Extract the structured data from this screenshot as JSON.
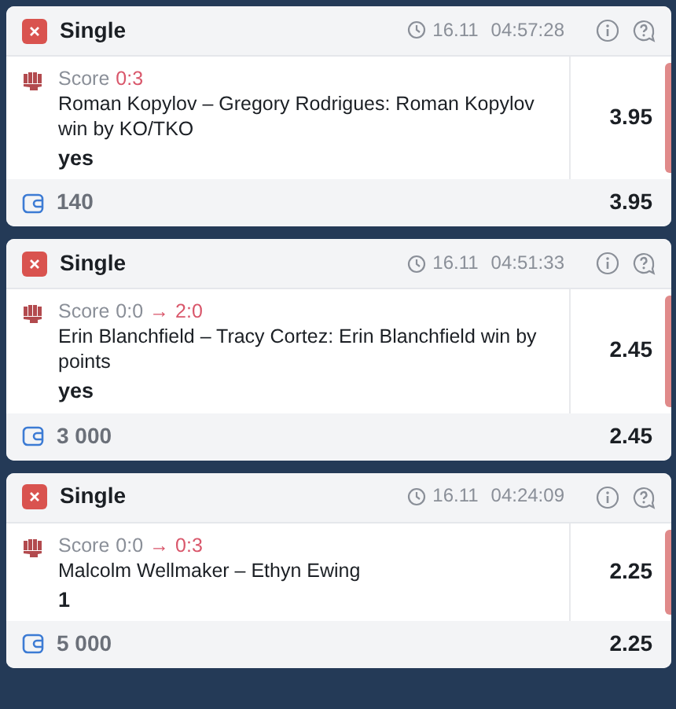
{
  "bets": [
    {
      "type": "Single",
      "lost": true,
      "date": "16.11",
      "time": "04:57:28",
      "score_label": "Score",
      "score_to": "0:3",
      "event": "Roman Kopylov – Gregory Rodrigues: Roman Kopylov win by KO/TKO",
      "pick": "yes",
      "odds": "3.95",
      "stake": "140",
      "total_odds": "3.95"
    },
    {
      "type": "Single",
      "lost": true,
      "date": "16.11",
      "time": "04:51:33",
      "score_label": "Score",
      "score_from": "0:0",
      "arrow": "→",
      "score_to": "2:0",
      "event": "Erin Blanchfield – Tracy Cortez: Erin Blanchfield win by points",
      "pick": "yes",
      "odds": "2.45",
      "stake": "3 000",
      "total_odds": "2.45"
    },
    {
      "type": "Single",
      "lost": true,
      "date": "16.11",
      "time": "04:24:09",
      "score_label": "Score",
      "score_from": "0:0",
      "arrow": "→",
      "score_to": "0:3",
      "event": "Malcolm Wellmaker – Ethyn Ewing",
      "pick": "1",
      "odds": "2.25",
      "stake": "5 000",
      "total_odds": "2.25"
    }
  ]
}
